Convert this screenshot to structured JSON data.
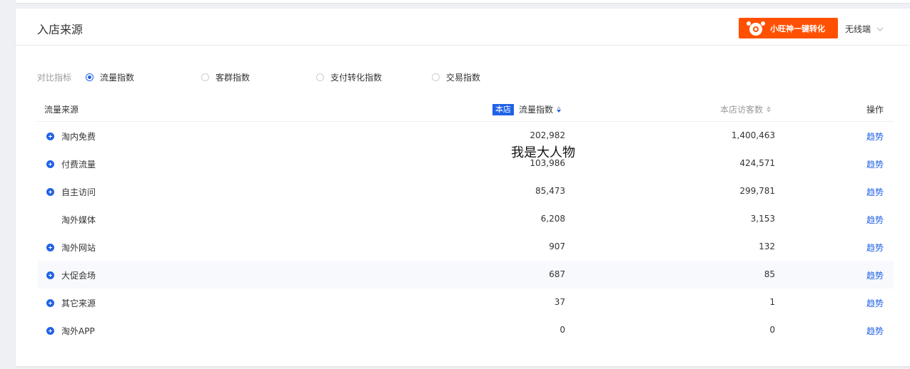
{
  "card": {
    "title": "入店来源",
    "convert_button": "小旺神一键转化",
    "terminal_select": "无线端"
  },
  "metrics": {
    "label": "对比指标",
    "options": [
      {
        "label": "流量指数",
        "checked": true
      },
      {
        "label": "客群指数",
        "checked": false
      },
      {
        "label": "支付转化指数",
        "checked": false
      },
      {
        "label": "交易指数",
        "checked": false
      }
    ]
  },
  "table": {
    "headers": {
      "source": "流量来源",
      "badge": "本店",
      "flow": "流量指数",
      "visitors": "本店访客数",
      "ops": "操作"
    },
    "rows": [
      {
        "name": "淘内免费",
        "flow": "202,982",
        "visitors": "1,400,463",
        "action": "趋势",
        "expandable": true
      },
      {
        "name": "付费流量",
        "flow": "103,986",
        "visitors": "424,571",
        "action": "趋势",
        "expandable": true
      },
      {
        "name": "自主访问",
        "flow": "85,473",
        "visitors": "299,781",
        "action": "趋势",
        "expandable": true
      },
      {
        "name": "淘外媒体",
        "flow": "6,208",
        "visitors": "3,153",
        "action": "趋势",
        "expandable": false
      },
      {
        "name": "淘外网站",
        "flow": "907",
        "visitors": "132",
        "action": "趋势",
        "expandable": true
      },
      {
        "name": "大促会场",
        "flow": "687",
        "visitors": "85",
        "action": "趋势",
        "expandable": true
      },
      {
        "name": "其它来源",
        "flow": "37",
        "visitors": "1",
        "action": "趋势",
        "expandable": true
      },
      {
        "name": "淘外APP",
        "flow": "0",
        "visitors": "0",
        "action": "趋势",
        "expandable": true
      }
    ]
  },
  "overlay": "我是大人物",
  "colors": {
    "accent": "#2062e6",
    "brand": "#ff5000"
  }
}
